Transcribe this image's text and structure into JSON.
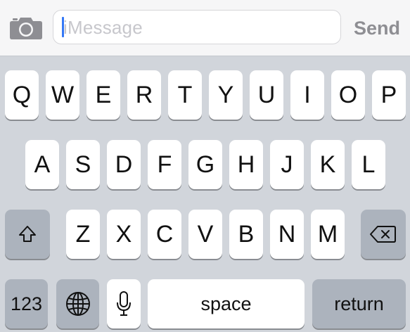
{
  "message_bar": {
    "camera_icon": "camera-icon",
    "placeholder": "iMessage",
    "send_label": "Send"
  },
  "keyboard": {
    "row1": [
      "Q",
      "W",
      "E",
      "R",
      "T",
      "Y",
      "U",
      "I",
      "O",
      "P"
    ],
    "row2": [
      "A",
      "S",
      "D",
      "F",
      "G",
      "H",
      "J",
      "K",
      "L"
    ],
    "row3": [
      "Z",
      "X",
      "C",
      "V",
      "B",
      "N",
      "M"
    ],
    "shift_icon": "shift-icon",
    "delete_icon": "delete-icon",
    "numbers_label": "123",
    "globe_icon": "globe-icon",
    "mic_icon": "microphone-icon",
    "space_label": "space",
    "return_label": "return"
  },
  "colors": {
    "caret": "#3478f6",
    "placeholder": "#c7c7cc",
    "send": "#8e8e93",
    "keyboard_bg": "#d1d5db",
    "key": "#ffffff",
    "function_key": "#acb3bd"
  }
}
